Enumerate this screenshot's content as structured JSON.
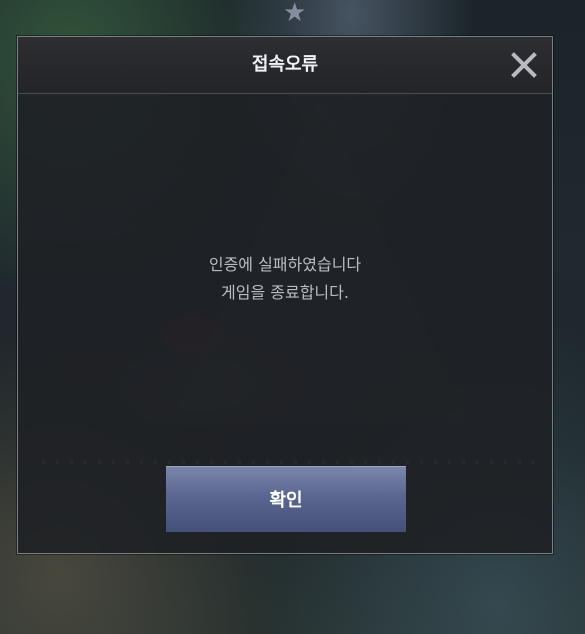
{
  "dialog": {
    "title": "접속오류",
    "message_lines": [
      "인증에 실패하였습니다",
      "게임을 종료합니다."
    ],
    "confirm_label": "확인",
    "close_icon": "close-icon"
  },
  "colors": {
    "dialog_background": "#222428",
    "dialog_border": "#969ba0",
    "title_text": "#f2f2f2",
    "message_text": "#b9bcc1",
    "button_top": "#7b87ac",
    "button_bottom": "#45507a"
  }
}
